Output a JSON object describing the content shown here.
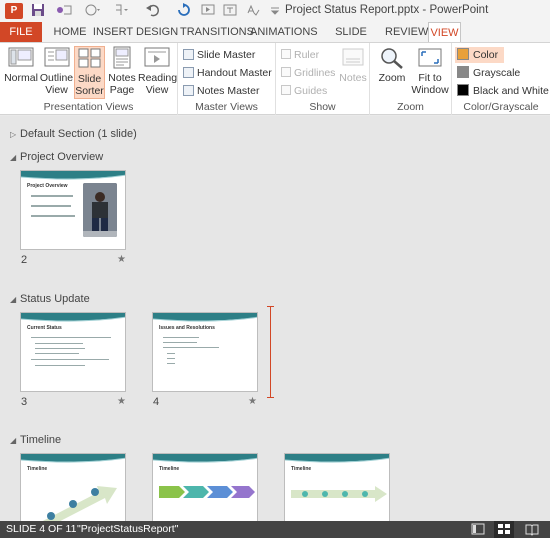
{
  "app": {
    "title": "Project Status Report.pptx - PowerPoint",
    "logo": "P"
  },
  "tabs": [
    "FILE",
    "HOME",
    "INSERT",
    "DESIGN",
    "TRANSITIONS",
    "ANIMATIONS",
    "SLIDE SHOW",
    "REVIEW",
    "VIEW"
  ],
  "ribbon": {
    "presentation_views": {
      "label": "Presentation Views",
      "buttons": [
        {
          "line1": "Normal",
          "line2": ""
        },
        {
          "line1": "Outline",
          "line2": "View"
        },
        {
          "line1": "Slide",
          "line2": "Sorter"
        },
        {
          "line1": "Notes",
          "line2": "Page"
        },
        {
          "line1": "Reading",
          "line2": "View"
        }
      ]
    },
    "master_views": {
      "label": "Master Views",
      "items": [
        "Slide Master",
        "Handout Master",
        "Notes Master"
      ]
    },
    "show": {
      "label": "Show",
      "checks": [
        "Ruler",
        "Gridlines",
        "Guides"
      ],
      "notes": "Notes"
    },
    "zoom": {
      "label": "Zoom",
      "zoom_btn": "Zoom",
      "fit_line1": "Fit to",
      "fit_line2": "Window"
    },
    "color": {
      "label": "Color/Grayscale",
      "items": [
        "Color",
        "Grayscale",
        "Black and White"
      ]
    }
  },
  "sections": [
    {
      "name": "Default Section (1 slide)"
    },
    {
      "name": "Project Overview"
    },
    {
      "name": "Status Update"
    },
    {
      "name": "Timeline"
    }
  ],
  "slides": {
    "s2": {
      "num": "2",
      "title": "Project Overview"
    },
    "s3": {
      "num": "3",
      "title": "Current Status"
    },
    "s4": {
      "num": "4",
      "title": "Issues and Resolutions"
    },
    "t1": {
      "title": "Timeline"
    },
    "t2": {
      "title": "Timeline"
    },
    "t3": {
      "title": "Timeline"
    }
  },
  "star": "★",
  "status": {
    "slide": "SLIDE 4 OF 11",
    "theme": "\"ProjectStatusReport\""
  },
  "colors": {
    "accent": "#d24726",
    "selected_bg": "#fcd9c6"
  }
}
